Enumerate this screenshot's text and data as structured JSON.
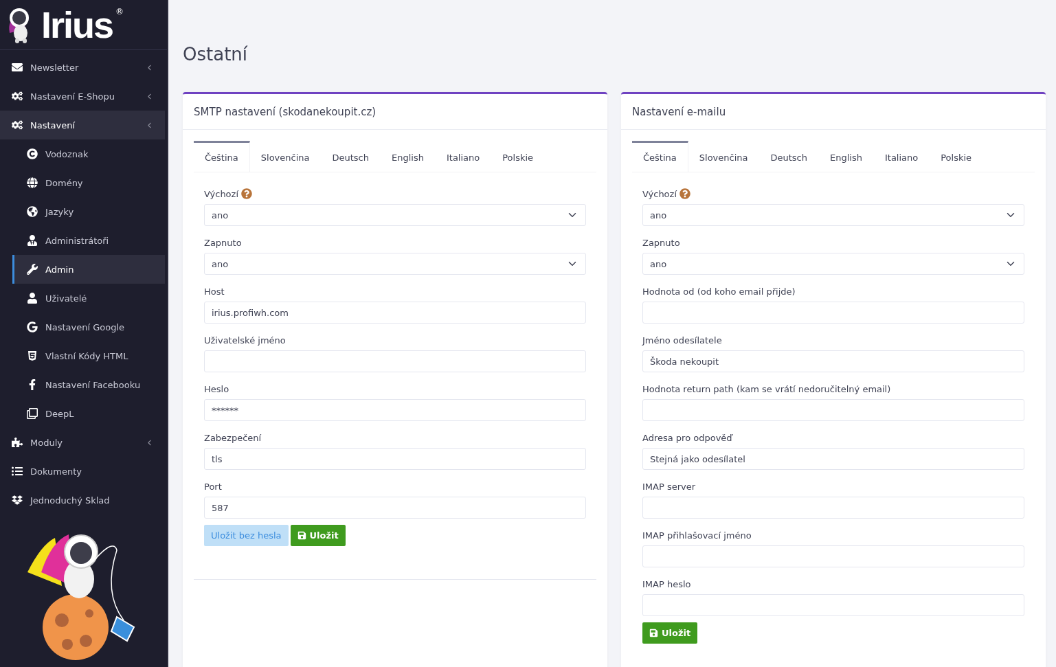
{
  "logo": {
    "text": "Irius",
    "mark": "®"
  },
  "sidebar": {
    "items": [
      {
        "label": "Newsletter",
        "submenu": true,
        "expanded": false
      },
      {
        "label": "Nastavení E-Shopu",
        "submenu": true,
        "expanded": false
      },
      {
        "label": "Nastavení",
        "submenu": true,
        "expanded": true,
        "children": [
          {
            "label": "Vodoznak",
            "selected": false
          },
          {
            "label": "Domény",
            "selected": false
          },
          {
            "label": "Jazyky",
            "selected": false
          },
          {
            "label": "Administrátoři",
            "selected": false
          },
          {
            "label": "Admin",
            "selected": true
          },
          {
            "label": "Uživatelé",
            "selected": false
          },
          {
            "label": "Nastavení Google",
            "selected": false
          },
          {
            "label": "Vlastní Kódy HTML",
            "selected": false
          },
          {
            "label": "Nastavení Facebooku",
            "selected": false
          },
          {
            "label": "DeepL",
            "selected": false
          }
        ]
      },
      {
        "label": "Moduly",
        "submenu": true,
        "expanded": false
      },
      {
        "label": "Dokumenty",
        "submenu": false,
        "expanded": false
      },
      {
        "label": "Jednoduchý Sklad",
        "submenu": false,
        "expanded": false
      }
    ]
  },
  "page_title": "Ostatní",
  "cards": [
    {
      "title": "SMTP nastavení (skodanekoupit.cz)",
      "footer_line": true,
      "tabs": [
        {
          "label": "Čeština",
          "selected": true
        },
        {
          "label": "Slovenčina",
          "selected": false
        },
        {
          "label": "Deutsch",
          "selected": false
        },
        {
          "label": "English",
          "selected": false
        },
        {
          "label": "Italiano",
          "selected": false
        },
        {
          "label": "Polskie",
          "selected": false
        }
      ],
      "fields": [
        {
          "kind": "select",
          "label": "Výchozí",
          "help": true,
          "value": "ano"
        },
        {
          "kind": "select",
          "label": "Zapnuto",
          "help": false,
          "value": "ano"
        },
        {
          "kind": "input",
          "label": "Host",
          "help": false,
          "value": "irius.profiwh.com"
        },
        {
          "kind": "input",
          "label": "Uživatelské jméno",
          "help": false
        },
        {
          "kind": "input",
          "label": "Heslo",
          "help": false,
          "value": "******"
        },
        {
          "kind": "input",
          "label": "Zabezpečení",
          "help": false,
          "value": "tls"
        },
        {
          "kind": "input",
          "label": "Port",
          "help": false,
          "value": "587"
        }
      ],
      "buttons": [
        {
          "kind": "light",
          "label": "Uložit bez hesla"
        },
        {
          "kind": "success",
          "label": "Uložit"
        }
      ]
    },
    {
      "title": "Nastavení e-mailu",
      "footer_line": false,
      "tabs": [
        {
          "label": "Čeština",
          "selected": true
        },
        {
          "label": "Slovenčina",
          "selected": false
        },
        {
          "label": "Deutsch",
          "selected": false
        },
        {
          "label": "English",
          "selected": false
        },
        {
          "label": "Italiano",
          "selected": false
        },
        {
          "label": "Polskie",
          "selected": false
        }
      ],
      "fields": [
        {
          "kind": "select",
          "label": "Výchozí",
          "help": true,
          "value": "ano"
        },
        {
          "kind": "select",
          "label": "Zapnuto",
          "help": false,
          "value": "ano"
        },
        {
          "kind": "input",
          "label": "Hodnota od (od koho email přijde)",
          "help": false
        },
        {
          "kind": "input",
          "label": "Jméno odesílatele",
          "help": false,
          "value": "Škoda nekoupit"
        },
        {
          "kind": "input",
          "label": "Hodnota return path (kam se vrátí nedoručitelný email)",
          "help": false
        },
        {
          "kind": "input",
          "label": "Adresa pro odpověď",
          "help": false,
          "value": "Stejná jako odesílatel"
        },
        {
          "kind": "input",
          "label": "IMAP server",
          "help": false
        },
        {
          "kind": "input",
          "label": "IMAP přihlašovací jméno",
          "help": false
        },
        {
          "kind": "input",
          "label": "IMAP heslo",
          "help": false
        }
      ],
      "buttons": [
        {
          "kind": "success",
          "label": "Uložit"
        }
      ]
    }
  ]
}
